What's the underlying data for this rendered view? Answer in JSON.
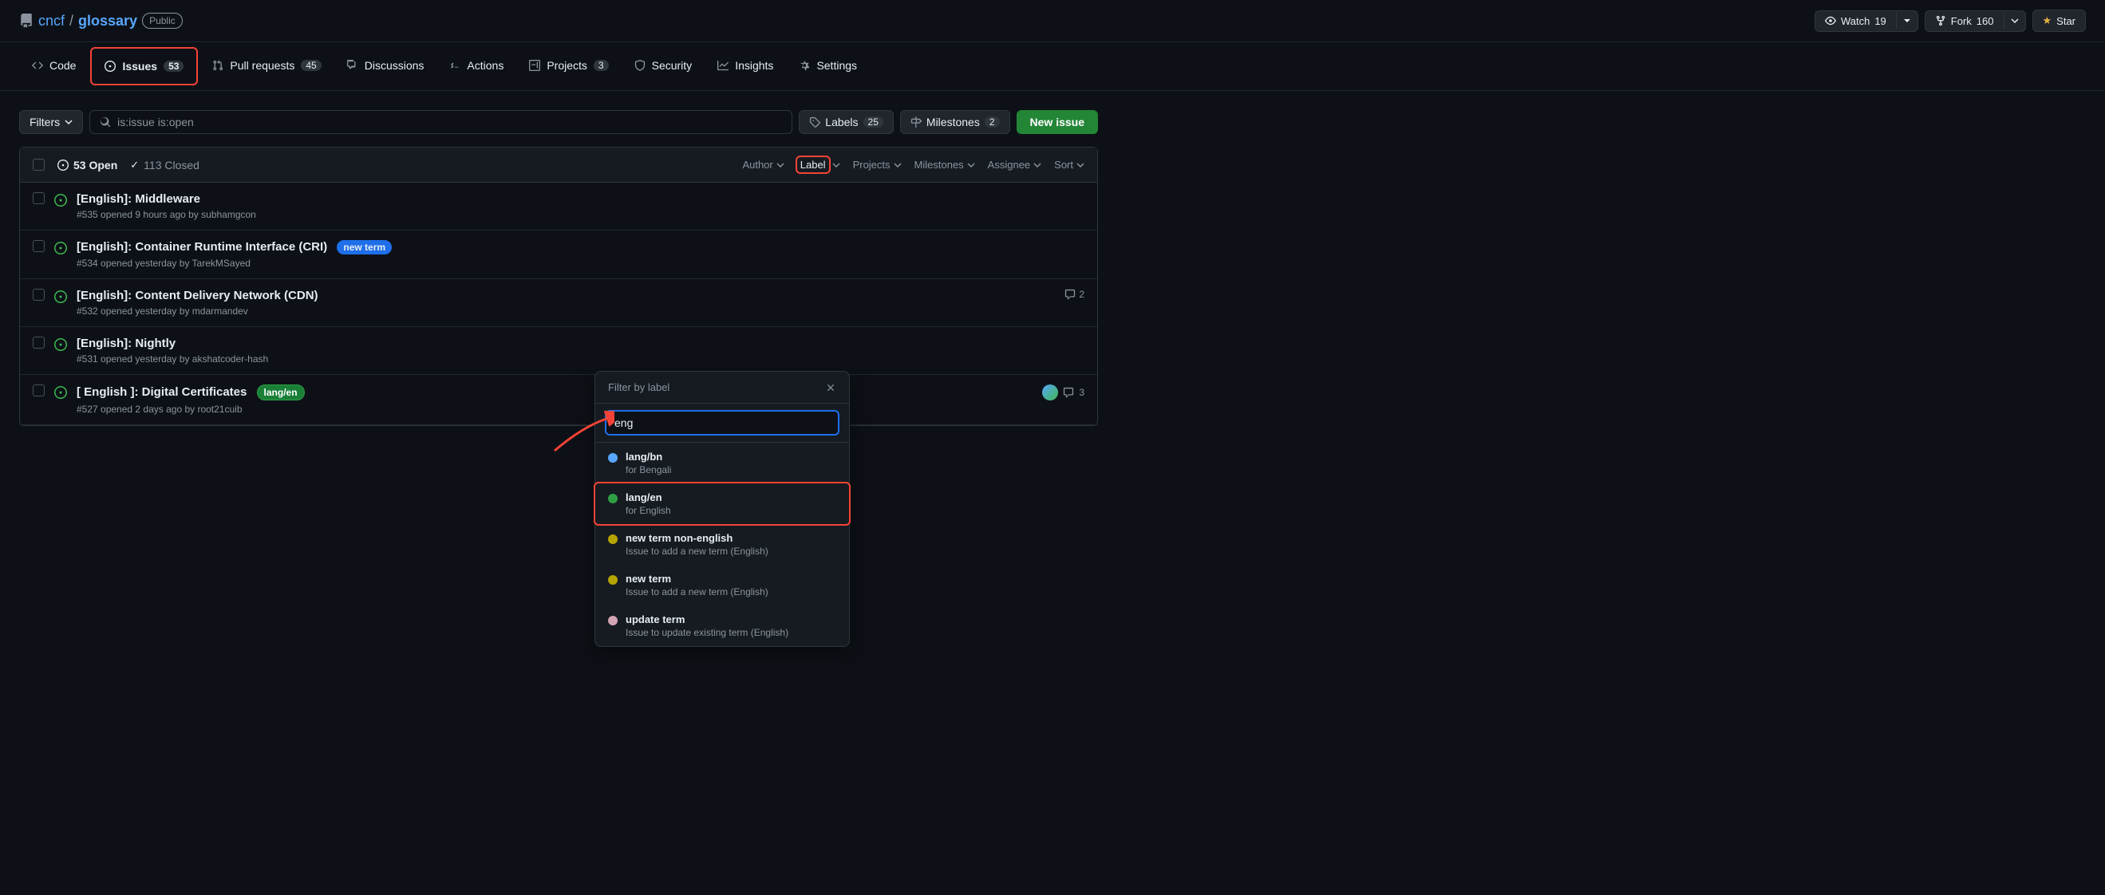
{
  "topbar": {
    "org": "cncf",
    "repo": "glossary",
    "public_label": "Public",
    "watch_label": "Watch",
    "watch_count": "19",
    "fork_label": "Fork",
    "fork_count": "160",
    "star_label": "Star"
  },
  "nav": {
    "tabs": [
      {
        "id": "code",
        "label": "Code",
        "count": null,
        "active": false
      },
      {
        "id": "issues",
        "label": "Issues",
        "count": "53",
        "active": true
      },
      {
        "id": "pullrequests",
        "label": "Pull requests",
        "count": "45",
        "active": false
      },
      {
        "id": "discussions",
        "label": "Discussions",
        "count": null,
        "active": false
      },
      {
        "id": "actions",
        "label": "Actions",
        "count": null,
        "active": false
      },
      {
        "id": "projects",
        "label": "Projects",
        "count": "3",
        "active": false
      },
      {
        "id": "security",
        "label": "Security",
        "count": null,
        "active": false
      },
      {
        "id": "insights",
        "label": "Insights",
        "count": null,
        "active": false
      },
      {
        "id": "settings",
        "label": "Settings",
        "count": null,
        "active": false
      }
    ]
  },
  "filterbar": {
    "filters_label": "Filters",
    "search_value": "is:issue is:open",
    "labels_label": "Labels",
    "labels_count": "25",
    "milestones_label": "Milestones",
    "milestones_count": "2",
    "new_issue_label": "New issue"
  },
  "issues_list": {
    "open_label": "53 Open",
    "closed_label": "113 Closed",
    "author_label": "Author",
    "label_label": "Label",
    "projects_label": "Projects",
    "milestones_label": "Milestones",
    "assignee_label": "Assignee",
    "sort_label": "Sort",
    "items": [
      {
        "title": "[English]: Middleware",
        "number": "#535",
        "time": "9 hours ago",
        "author": "subhamgcon",
        "labels": [],
        "comments": null
      },
      {
        "title": "[English]: Container Runtime Interface (CRI)",
        "number": "#534",
        "time": "yesterday",
        "author": "TarekMSayed",
        "labels": [
          "new term"
        ],
        "comments": null
      },
      {
        "title": "[English]: Content Delivery Network (CDN)",
        "number": "#532",
        "time": "yesterday",
        "author": "mdarmandev",
        "labels": [],
        "comments": "2"
      },
      {
        "title": "[English]: Nightly",
        "number": "#531",
        "time": "yesterday",
        "author": "akshatcoder-hash",
        "labels": [],
        "comments": null
      },
      {
        "title": "[ English ]: Digital Certificates",
        "number": "#527",
        "time": "2 days ago",
        "author": "root21cuib",
        "labels": [
          "lang/en"
        ],
        "comments": "3"
      }
    ]
  },
  "filter_dropdown": {
    "title": "Filter by label",
    "search_placeholder": "eng",
    "search_value": "eng",
    "items": [
      {
        "id": "lang-bn",
        "name": "lang/bn",
        "description": "for Bengali",
        "color": "#58a6ff",
        "selected": false
      },
      {
        "id": "lang-en",
        "name": "lang/en",
        "description": "for English",
        "color": "#2ea043",
        "selected": true
      },
      {
        "id": "new-term-non-english",
        "name": "new term non-english",
        "description": "Issue to add a new term (English)",
        "color": "#b5a400",
        "selected": false
      },
      {
        "id": "new-term",
        "name": "new term",
        "description": "Issue to add a new term (English)",
        "color": "#b5a400",
        "selected": false
      },
      {
        "id": "update-term",
        "name": "update term",
        "description": "Issue to update existing term (English)",
        "color": "#d2a4b4",
        "selected": false
      }
    ]
  }
}
